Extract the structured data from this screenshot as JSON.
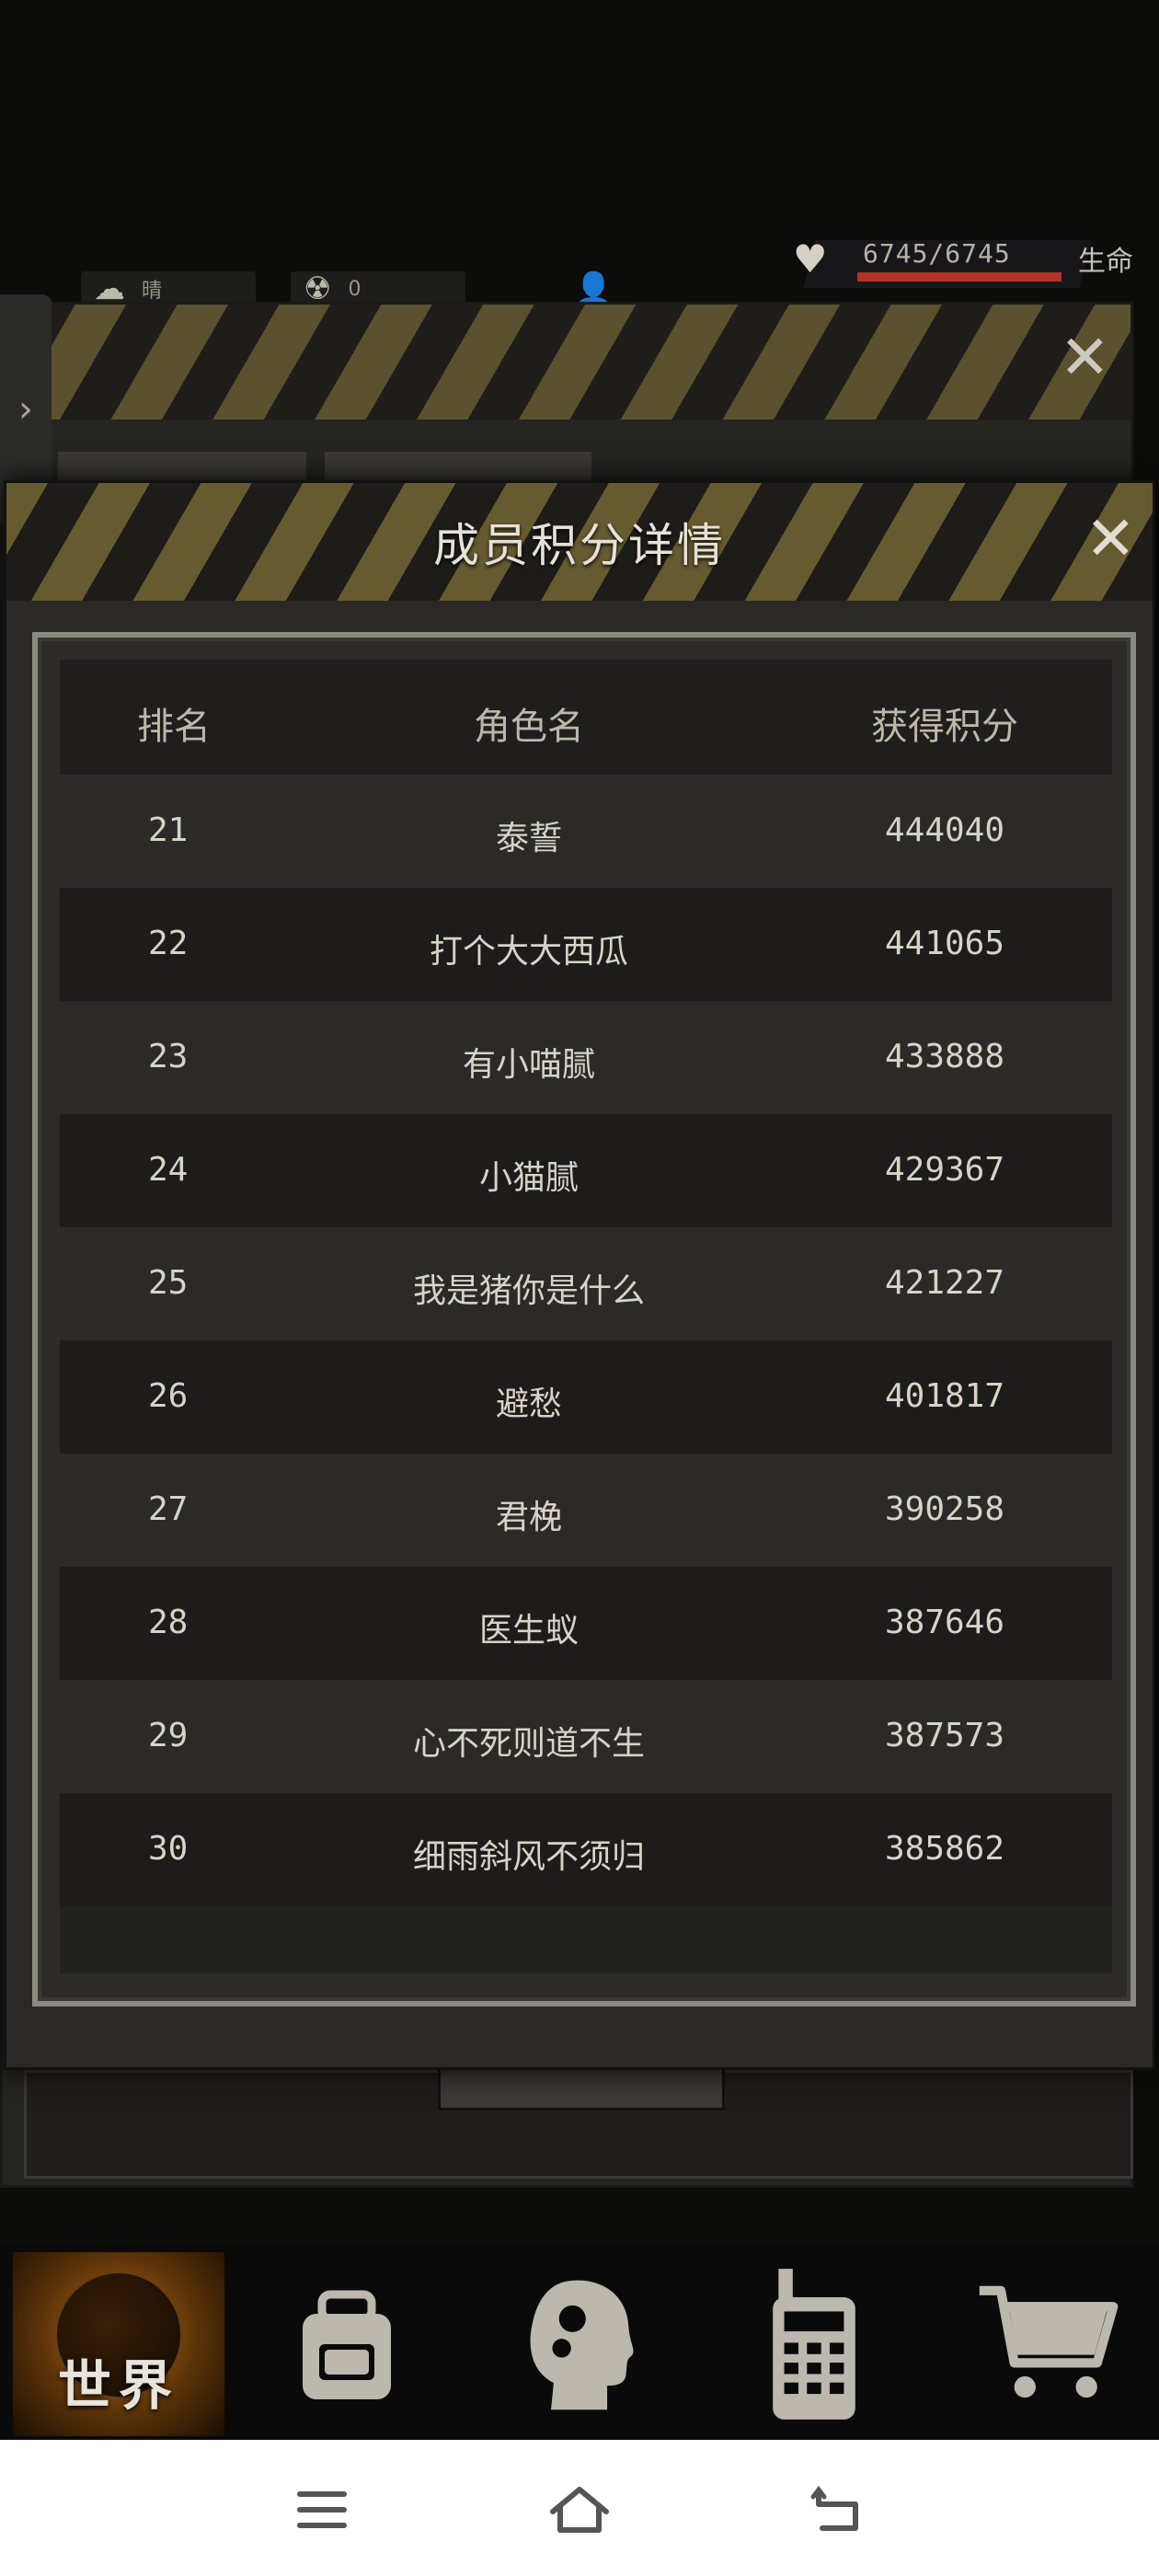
{
  "hud": {
    "weather": "晴",
    "radiation": "0",
    "health_value": "6745/6745",
    "health_fraction": 1.0,
    "health_label": "生命",
    "health_color": "#b33327"
  },
  "modal": {
    "title": "成员积分详情",
    "columns": {
      "rank": "排名",
      "name": "角色名",
      "score": "获得积分"
    },
    "rows": [
      {
        "rank": "21",
        "name": "泰誓",
        "score": "444040"
      },
      {
        "rank": "22",
        "name": "打个大大西瓜",
        "score": "441065"
      },
      {
        "rank": "23",
        "name": "有小喵腻",
        "score": "433888"
      },
      {
        "rank": "24",
        "name": "小猫腻",
        "score": "429367"
      },
      {
        "rank": "25",
        "name": "我是猪你是什么",
        "score": "421227"
      },
      {
        "rank": "26",
        "name": "避愁",
        "score": "401817"
      },
      {
        "rank": "27",
        "name": "君梚",
        "score": "390258"
      },
      {
        "rank": "28",
        "name": "医生蚁",
        "score": "387646"
      },
      {
        "rank": "29",
        "name": "心不死则道不生",
        "score": "387573"
      },
      {
        "rank": "30",
        "name": "细雨斜风不须归",
        "score": "385862"
      }
    ]
  },
  "nav": {
    "world_label": "世界",
    "items": [
      "globe-icon",
      "backpack-icon",
      "brain-icon",
      "radio-icon",
      "cart-icon"
    ]
  },
  "colors": {
    "accent_stripe": "#6d6032",
    "world_glow": "#b96a1c"
  }
}
